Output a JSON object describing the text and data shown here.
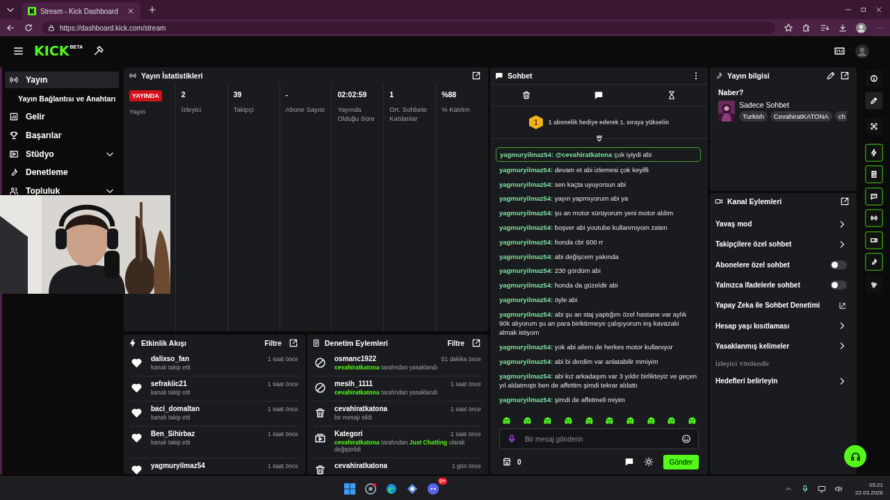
{
  "browser": {
    "tab_title": "Stream - Kick Dashboard",
    "url": "https://dashboard.kick.com/stream"
  },
  "header": {
    "logo": "KICK",
    "logo_badge": "BETA"
  },
  "sidebar": {
    "items": [
      {
        "label": "Yayın",
        "selected": true,
        "expandable": false,
        "children": [
          {
            "label": "Yayın Bağlantısı ve Anahtarı",
            "selected": false
          }
        ]
      },
      {
        "label": "Gelir",
        "selected": false,
        "expandable": false
      },
      {
        "label": "Başarılar",
        "selected": false,
        "expandable": false
      },
      {
        "label": "Stüdyo",
        "selected": false,
        "expandable": true
      },
      {
        "label": "Denetleme",
        "selected": false,
        "expandable": false
      },
      {
        "label": "Topluluk",
        "selected": false,
        "expandable": true
      }
    ]
  },
  "stats": {
    "title": "Yayın İstatistikleri",
    "items": [
      {
        "kind": "badge",
        "value": "YAYINDA",
        "label": "Yayın"
      },
      {
        "kind": "number",
        "value": "2",
        "label": "İzleyici"
      },
      {
        "kind": "number",
        "value": "39",
        "label": "Takipçi"
      },
      {
        "kind": "number",
        "value": "-",
        "label": "Abone Sayısı"
      },
      {
        "kind": "number",
        "value": "02:02:59",
        "label": "Yayında Olduğu Süre"
      },
      {
        "kind": "number",
        "value": "1",
        "label": "Ort. Sohbete Katılanlar"
      },
      {
        "kind": "number",
        "value": "%88",
        "label": "% Katılım"
      }
    ]
  },
  "activity": {
    "title": "Etkinlik Akışı",
    "filter": "Filtre",
    "events": [
      {
        "user": "dalixso_fan",
        "action": "kanalı takip etti",
        "time": "1 saat önce"
      },
      {
        "user": "sefrakiic21",
        "action": "kanalı takip etti",
        "time": "1 saat önce"
      },
      {
        "user": "baci_domaltan",
        "action": "kanalı takip etti",
        "time": "1 saat önce"
      },
      {
        "user": "Ben_Sihirbaz",
        "action": "kanalı takip etti",
        "time": "1 saat önce"
      },
      {
        "user": "yagmuryilmaz54",
        "time": "1 saat önce"
      }
    ]
  },
  "moderation": {
    "title": "Denetim Eylemleri",
    "filter": "Filtre",
    "actions": [
      {
        "target": "osmanc1922",
        "time": "51 dakika önce",
        "parts": [
          {
            "text": "cevahiratkatona",
            "highlight": true
          },
          {
            "text": " tarafından yasaklandı",
            "highlight": false
          }
        ]
      },
      {
        "target": "mesih_1111",
        "time": "1 saat önce",
        "parts": [
          {
            "text": "cevahiratkatona",
            "highlight": true
          },
          {
            "text": " tarafından yasaklandı",
            "highlight": false
          }
        ]
      },
      {
        "target": "cevahiratkatona",
        "time": "1 saat önce",
        "parts": [
          {
            "text": "bir mesajı sildi",
            "highlight": false
          }
        ]
      },
      {
        "target": "Kategori",
        "time": "1 saat önce",
        "parts": [
          {
            "text": "cevahiratkatona",
            "highlight": true
          },
          {
            "text": " tarafından ",
            "highlight": false
          },
          {
            "text": "Just Chatting",
            "highlight": true
          },
          {
            "text": " olarak değiştirildi",
            "highlight": false
          }
        ]
      },
      {
        "target": "cevahiratkatona",
        "time": "1 gün önce"
      }
    ]
  },
  "chat": {
    "title": "Sohbet",
    "leaderboard": {
      "rank": "1",
      "text": "1 abonelik hediye ederek 1. sıraya yükselin"
    },
    "messages": [
      {
        "user": "yagmuryilmaz54:",
        "mention": "@cevahiratkatona",
        "text": "çok iyiydi abi",
        "highlighted": true
      },
      {
        "user": "yagmuryilmaz54:",
        "text": "devam et abi izlemesi çok keyifli",
        "highlighted": false
      },
      {
        "user": "yagmuryilmaz54:",
        "text": "sen kaçta uyuyorsun abi",
        "highlighted": false
      },
      {
        "user": "yagmuryilmaz54:",
        "text": "yayın yapmıyorum abi ya",
        "highlighted": false
      },
      {
        "user": "yagmuryilmaz54:",
        "text": "şu an motor sürüyorum yeni motor aldım",
        "highlighted": false
      },
      {
        "user": "yagmuryilmaz54:",
        "text": "boşver abi youtube kullanmıyom zaten",
        "highlighted": false
      },
      {
        "user": "yagmuryilmaz54:",
        "text": "honda cbr 600 rr",
        "highlighted": false
      },
      {
        "user": "yagmuryilmaz54:",
        "text": "abi değişcem yakında",
        "highlighted": false
      },
      {
        "user": "yagmuryilmaz54:",
        "text": "230 gördüm abi",
        "highlighted": false
      },
      {
        "user": "yagmuryilmaz54:",
        "text": "honda da güzeldir abi",
        "highlighted": false
      },
      {
        "user": "yagmuryilmaz54:",
        "text": "öyle abi",
        "highlighted": false
      },
      {
        "user": "yagmuryilmaz54:",
        "text": "abi şu an staj yaptığım özel hastane var aylık 90k alıyorum şu an para biriktirmeye çalışıyorum inş kavazaki almak istiyom",
        "highlighted": false
      },
      {
        "user": "yagmuryilmaz54:",
        "text": "yok abi ailem de herkes motor kullanıyor",
        "highlighted": false
      },
      {
        "user": "yagmuryilmaz54:",
        "text": "abi bi derdim var anlatabilir mmiyim",
        "highlighted": false
      },
      {
        "user": "yagmuryilmaz54:",
        "text": "abi kız arkadaşım var 3 yıldır birlikteyiz ve geçen yıl aldatmıştı ben de affettim şimdi tekrar aldattı",
        "highlighted": false
      },
      {
        "user": "yagmuryilmaz54:",
        "text": "şimdi de affetmeli miyim",
        "highlighted": false
      }
    ],
    "input": {
      "placeholder": "Bir mesaj gönderin"
    },
    "points": "0",
    "send": "Gönder"
  },
  "stream_info": {
    "title": "Yayın bilgisi",
    "stream_title": "Naber?",
    "category": "Sadece Sohbet",
    "tags": [
      "Turkish",
      "CevahiratKATONA",
      "ch"
    ]
  },
  "channel_actions": {
    "title": "Kanal Eylemleri",
    "items": [
      {
        "kind": "link",
        "label": "Yavaş mod"
      },
      {
        "kind": "link",
        "label": "Takipçilere özel sohbet"
      },
      {
        "kind": "toggle",
        "label": "Abonelere özel sohbet",
        "on": false
      },
      {
        "kind": "toggle",
        "label": "Yalnızca ifadelerle sohbet",
        "on": false
      },
      {
        "kind": "external",
        "label": "Yapay Zeka ile Sohbet Denetimi"
      },
      {
        "kind": "link",
        "label": "Hesap yaşı kısıtlaması"
      },
      {
        "kind": "link",
        "label": "Yasaklanmış kelimeler"
      },
      {
        "kind": "heading",
        "label": "İzleyici Yönlendir"
      },
      {
        "kind": "link",
        "label": "Hedefleri belirleyin"
      }
    ]
  },
  "rail": [
    {
      "on": false
    },
    {
      "on": false
    },
    {
      "on": false
    },
    {
      "on": true
    },
    {
      "on": true
    },
    {
      "on": true
    },
    {
      "on": true
    },
    {
      "on": true
    },
    {
      "on": true
    },
    {
      "on": false
    }
  ],
  "taskbar": {
    "notification_count": "9+",
    "time": "05:21",
    "date": "22.03.2026"
  }
}
